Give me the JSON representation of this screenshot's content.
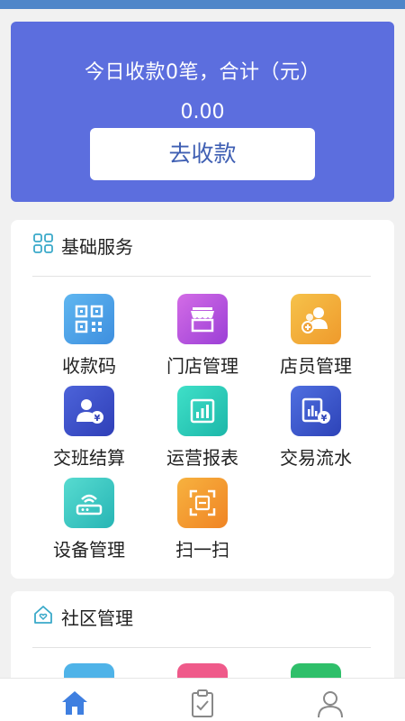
{
  "summary": {
    "title": "今日收款0笔，合计（元）",
    "amount": "0.00",
    "collect_button": "去收款"
  },
  "basic_services": {
    "title": "基础服务",
    "items": [
      {
        "label": "收款码",
        "icon": "qr-code-icon"
      },
      {
        "label": "门店管理",
        "icon": "store-icon"
      },
      {
        "label": "店员管理",
        "icon": "staff-icon"
      },
      {
        "label": "交班结算",
        "icon": "shift-settlement-icon"
      },
      {
        "label": "运营报表",
        "icon": "report-chart-icon"
      },
      {
        "label": "交易流水",
        "icon": "transaction-flow-icon"
      },
      {
        "label": "设备管理",
        "icon": "device-router-icon"
      },
      {
        "label": "扫一扫",
        "icon": "scan-icon"
      }
    ]
  },
  "community": {
    "title": "社区管理"
  },
  "bottom_nav": {
    "items": [
      {
        "name": "home",
        "icon": "home-icon",
        "active": true
      },
      {
        "name": "tasks",
        "icon": "clipboard-check-icon",
        "active": false
      },
      {
        "name": "profile",
        "icon": "user-icon",
        "active": false
      }
    ]
  },
  "colors": {
    "hero_bg": "#5c6ede",
    "accent": "#3f7fe0",
    "topbar": "#4f86c9"
  }
}
